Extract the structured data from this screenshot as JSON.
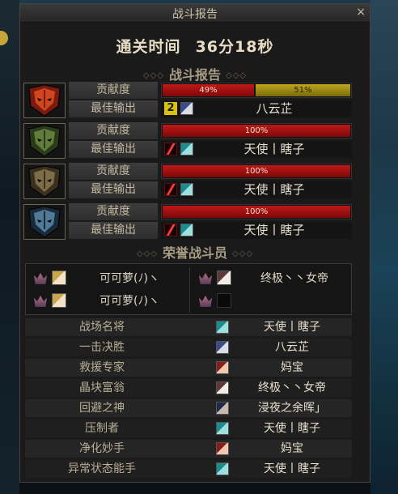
{
  "window": {
    "title": "战斗报告",
    "close_glyph": "×"
  },
  "clear_time": {
    "label": "通关时间",
    "value": "36分18秒"
  },
  "battle_report": {
    "title": "战斗报告",
    "ornament": "◇◇◇",
    "bosses": [
      {
        "icon": "red-flame-mask-icon",
        "contribution_label": "贡献度",
        "segments": [
          {
            "percent": 49,
            "label": "49%",
            "color": "red"
          },
          {
            "percent": 51,
            "label": "51%",
            "color": "gold"
          }
        ],
        "best_label": "最佳输出",
        "best_class_icon": "rank-2-icon",
        "best_avatar_icon": "silver-hair-avatar-icon",
        "best_player": "八云芷"
      },
      {
        "icon": "green-mask-icon",
        "contribution_label": "贡献度",
        "segments": [
          {
            "percent": 100,
            "label": "100%",
            "color": "red"
          }
        ],
        "best_label": "最佳输出",
        "best_class_icon": "slash-skill-icon",
        "best_avatar_icon": "teal-avatar-icon",
        "best_player": "天使丨瞎子"
      },
      {
        "icon": "gold-mask-icon",
        "contribution_label": "贡献度",
        "segments": [
          {
            "percent": 100,
            "label": "100%",
            "color": "red"
          }
        ],
        "best_label": "最佳输出",
        "best_class_icon": "slash-skill-icon",
        "best_avatar_icon": "teal-avatar-icon",
        "best_player": "天使丨瞎子"
      },
      {
        "icon": "blue-mask-icon",
        "contribution_label": "贡献度",
        "segments": [
          {
            "percent": 100,
            "label": "100%",
            "color": "red"
          }
        ],
        "best_label": "最佳输出",
        "best_class_icon": "slash-skill-icon",
        "best_avatar_icon": "teal-avatar-icon",
        "best_player": "天使丨瞎子"
      }
    ]
  },
  "honor": {
    "title": "荣誉战斗员",
    "members": [
      {
        "name": "可可萝(ﾉ)ヽ",
        "medal": "crown-medal-icon",
        "avatar": "blonde-avatar-icon"
      },
      {
        "name": "终极丶丶女帝",
        "medal": "crown-medal-icon",
        "avatar": "white-hair-avatar-icon"
      },
      {
        "name": "可可萝(ﾉ)ヽ",
        "medal": "crown-medal-icon",
        "avatar": "blonde-avatar-icon"
      },
      {
        "name": "",
        "medal": "crown-medal-icon",
        "avatar": "empty-avatar-icon"
      }
    ]
  },
  "awards": [
    {
      "title": "战场名将",
      "avatar": "teal-avatar-icon",
      "player": "天使丨瞎子"
    },
    {
      "title": "一击决胜",
      "avatar": "silver-hair-avatar-icon",
      "player": "八云芷"
    },
    {
      "title": "救援专家",
      "avatar": "red-hair-avatar-icon",
      "player": "妈宝"
    },
    {
      "title": "晶块富翁",
      "avatar": "white-hair-avatar-icon",
      "player": "终极丶丶女帝"
    },
    {
      "title": "回避之神",
      "avatar": "dark-hair-avatar-icon",
      "player": "浸夜之余晖」"
    },
    {
      "title": "压制者",
      "avatar": "teal-avatar-icon",
      "player": "天使丨瞎子"
    },
    {
      "title": "净化妙手",
      "avatar": "red-hair-avatar-icon",
      "player": "妈宝"
    },
    {
      "title": "异常状态能手",
      "avatar": "teal-avatar-icon",
      "player": "天使丨瞎子"
    }
  ],
  "colors": {
    "bar_red": "#a01010",
    "bar_gold": "#a89012",
    "text_gold": "#e8dcc4",
    "label_tan": "#c4b9a0"
  }
}
